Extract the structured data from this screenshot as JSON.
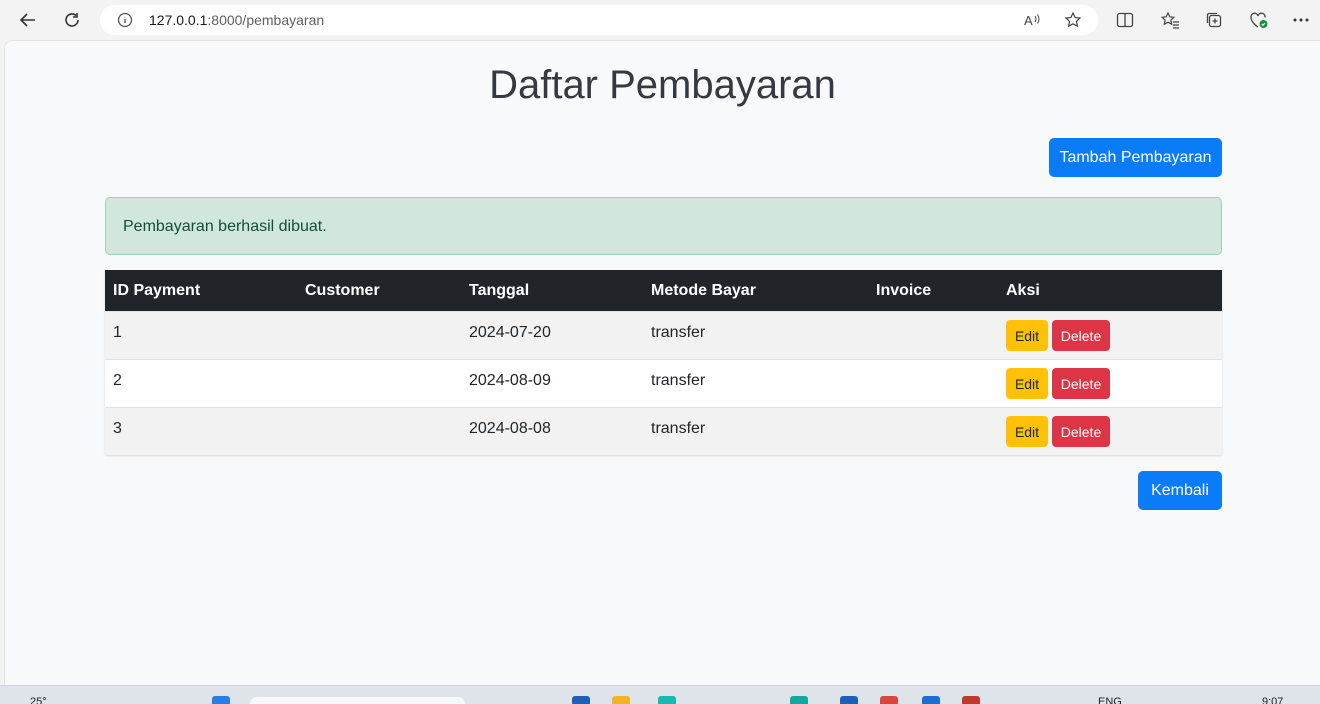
{
  "browser": {
    "url_host": "127.0.0.1",
    "url_rest": ":8000/pembayaran"
  },
  "page": {
    "title": "Daftar Pembayaran",
    "add_button": "Tambah Pembayaran",
    "back_button": "Kembali",
    "alert": "Pembayaran berhasil dibuat."
  },
  "table": {
    "headers": [
      "ID Payment",
      "Customer",
      "Tanggal",
      "Metode Bayar",
      "Invoice",
      "Aksi"
    ],
    "rows": [
      {
        "id": "1",
        "customer": "",
        "tanggal": "2024-07-20",
        "metode": "transfer",
        "invoice": "",
        "edit": "Edit",
        "delete": "Delete"
      },
      {
        "id": "2",
        "customer": "",
        "tanggal": "2024-08-09",
        "metode": "transfer",
        "invoice": "",
        "edit": "Edit",
        "delete": "Delete"
      },
      {
        "id": "3",
        "customer": "",
        "tanggal": "2024-08-08",
        "metode": "transfer",
        "invoice": "",
        "edit": "Edit",
        "delete": "Delete"
      }
    ]
  },
  "taskbar": {
    "weather": "25°",
    "lang": "ENG",
    "time": "9:07"
  },
  "colors": {
    "primary": "#0a7cf7",
    "warning": "#ffc107",
    "danger": "#dc3545",
    "success_bg": "#d1e7dd",
    "table_head": "#212529"
  },
  "icons": [
    "back-arrow-icon",
    "refresh-icon",
    "info-icon",
    "read-aloud-icon",
    "favorite-star-icon",
    "split-screen-icon",
    "favorites-icon",
    "collections-icon",
    "browser-essentials-icon",
    "more-icon"
  ]
}
